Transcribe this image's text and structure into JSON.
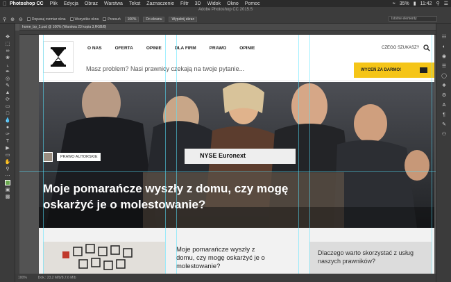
{
  "menubar": {
    "app": "Photoshop CC",
    "items": [
      "Plik",
      "Edycja",
      "Obraz",
      "Warstwa",
      "Tekst",
      "Zaznaczenie",
      "Filtr",
      "3D",
      "Widok",
      "Okno",
      "Pomoc"
    ],
    "battery": "35%",
    "clock": "11:42"
  },
  "options": {
    "window_title": "Adobe Photoshop CC 2015.5",
    "resize_windows": "Dopasuj rozmiar okna",
    "all_windows": "Wszystkie okna",
    "scrubby": "Przesuń",
    "zoom_100": "100%",
    "fit_screen": "Do ekranu",
    "fill_screen": "Wypełnij ekran",
    "workspace": "Istotne elementy"
  },
  "document": {
    "tab": "home_bp_2.psd @ 100% (Warstwa 23 kopia 3,RGB/8)"
  },
  "status": {
    "zoom": "100%",
    "doc": "Dok.: 23,2 M/b/8,7,6 M/b"
  },
  "site": {
    "nav": [
      "O NAS",
      "OFERTA",
      "OPINIE",
      "DLA FIRM",
      "PRAWO",
      "OPINIE"
    ],
    "search_label": "CZEGO SZUKASZ?",
    "tagline": "Masz problem? Nasi prawnicy czekają na twoje pytanie...",
    "cta": "WYCEŃ ZA DARMO!",
    "hero_tag": "PRAWO AUTORSKIE",
    "hero_title": "Moje pomarańcze wyszły z domu, czy mogę oskarżyć je o molestowanie?",
    "hero_sign": "NYSE Euronext",
    "card_title": "Moje pomarańcze wyszły z domu, czy mogę oskarżyć je o molestowanie?",
    "card_side": "Dlaczego warto skorzystać z usług naszych prawników?"
  }
}
